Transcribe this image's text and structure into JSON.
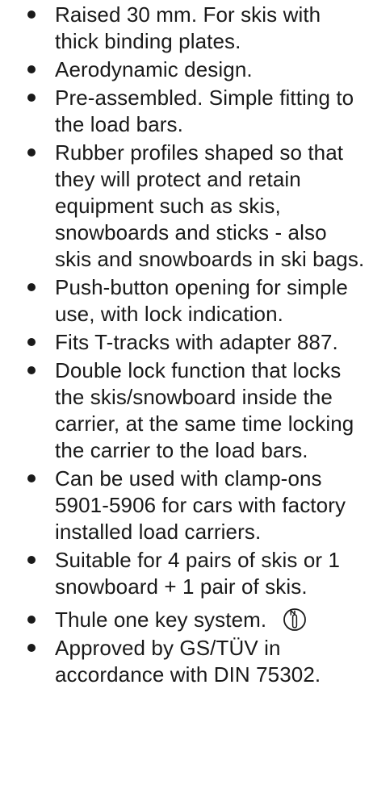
{
  "features": [
    {
      "text": "Raised 30 mm. For skis with thick binding plates."
    },
    {
      "text": "Aerodynamic design."
    },
    {
      "text": "Pre-assembled. Simple fitting to the load bars."
    },
    {
      "text": "Rubber profiles shaped so that they will protect and retain equipment such as skis, snowboards and sticks - also skis and snowboards in ski bags."
    },
    {
      "text": "Push-button opening for simple use, with lock indication."
    },
    {
      "text": "Fits T-tracks with adapter 887."
    },
    {
      "text": "Double lock function that locks the skis/snowboard inside the carrier, at the same time locking the carrier to the load bars."
    },
    {
      "text": "Can be used with clamp-ons 5901-5906 for cars with factory installed load carriers."
    },
    {
      "text": "Suitable for 4 pairs of skis or 1 snowboard + 1 pair of skis."
    },
    {
      "text": "Thule one key system.",
      "icon": "one-key-system-icon"
    },
    {
      "text": "Approved by GS/TÜV in accordance with DIN 75302."
    }
  ]
}
